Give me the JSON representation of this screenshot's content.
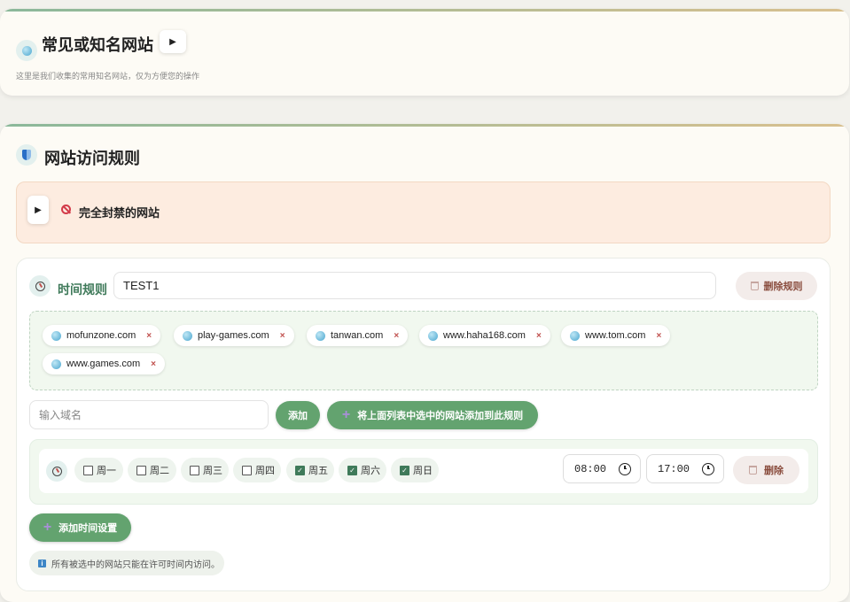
{
  "section1": {
    "title": "常见或知名网站",
    "subtitle": "这里是我们收集的常用知名网站，仅为方便您的操作",
    "toggle_icon": "play-icon"
  },
  "section2": {
    "title": "网站访问规则",
    "blocked": {
      "label": "完全封禁的网站",
      "toggle_icon": "play-icon"
    },
    "rule": {
      "label": "时间规则",
      "name_value": "TEST1",
      "delete_label": "删除规则",
      "domains": [
        {
          "name": "mofunzone.com"
        },
        {
          "name": "play-games.com"
        },
        {
          "name": "tanwan.com"
        },
        {
          "name": "www.haha168.com"
        },
        {
          "name": "www.tom.com"
        },
        {
          "name": "www.games.com"
        }
      ],
      "remove_symbol": "×",
      "domain_input_placeholder": "输入域名",
      "add_label": "添加",
      "add_selected_label": "将上面列表中选中的网站添加到此规则",
      "schedule": {
        "days": [
          {
            "label": "周一",
            "checked": false
          },
          {
            "label": "周二",
            "checked": false
          },
          {
            "label": "周三",
            "checked": false
          },
          {
            "label": "周四",
            "checked": false
          },
          {
            "label": "周五",
            "checked": true
          },
          {
            "label": "周六",
            "checked": true
          },
          {
            "label": "周日",
            "checked": true
          }
        ],
        "start_time": "08:00",
        "end_time": "17:00",
        "delete_label": "删除"
      },
      "add_time_label": "添加时间设置",
      "note": "所有被选中的网站只能在许可时间内访问。"
    }
  },
  "colors": {
    "accent": "#63a36f",
    "accent_text": "#3f7a5a",
    "danger_text": "#8a4d3e",
    "blocked_bg": "#fdece0"
  }
}
